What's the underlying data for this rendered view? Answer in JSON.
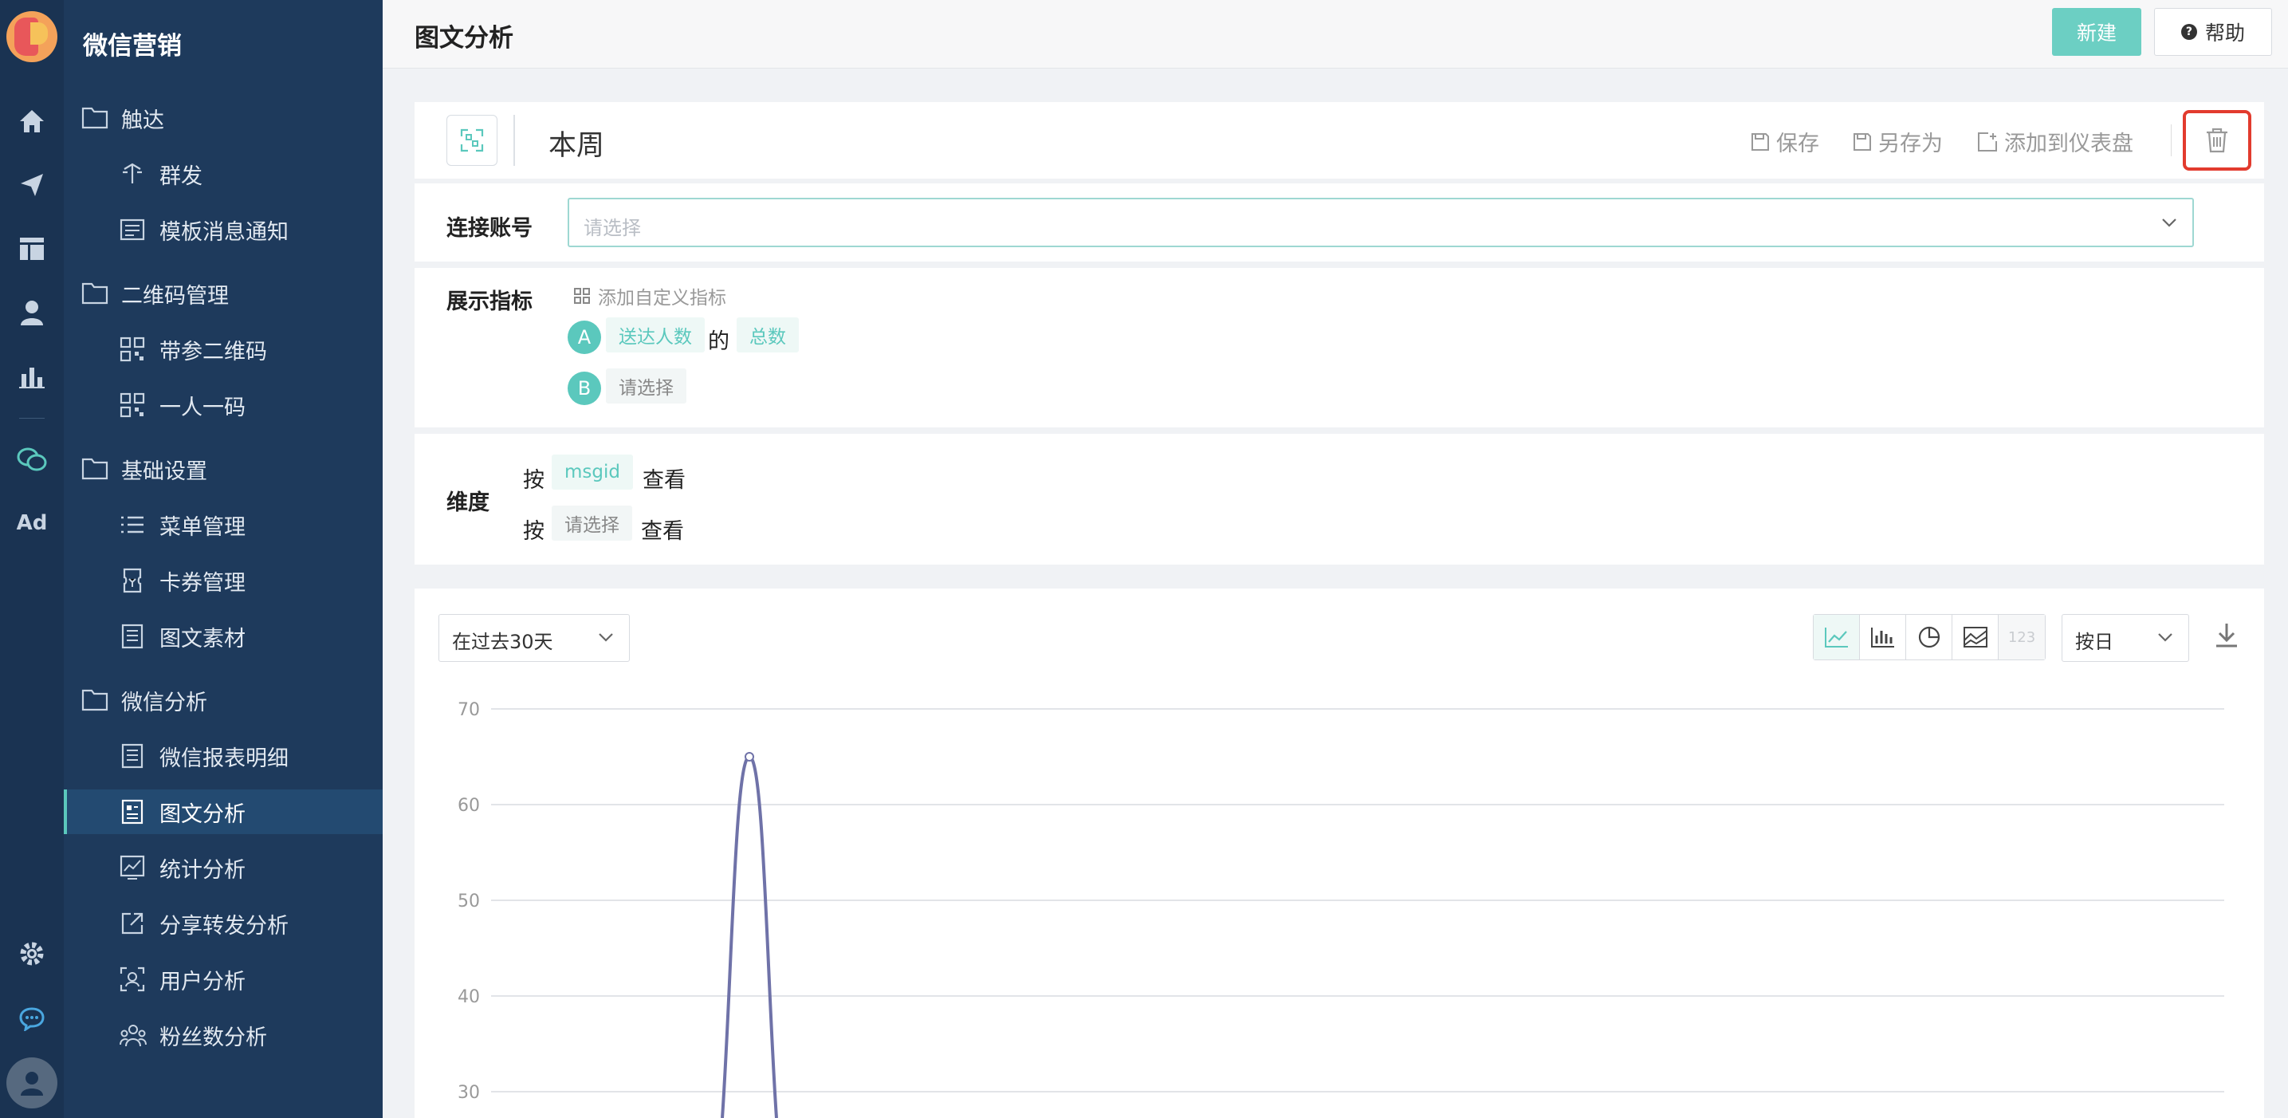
{
  "app": {
    "nav_title": "微信营销"
  },
  "rail": {
    "icons": [
      "home-icon",
      "send-icon",
      "dashboard-icon",
      "user-icon",
      "bar-chart-icon",
      "wechat-icon",
      "ad-icon",
      "settings-icon",
      "chat-icon",
      "avatar"
    ],
    "ad_label": "Ad"
  },
  "nav": {
    "groups": [
      {
        "label": "触达",
        "items": [
          {
            "label": "群发",
            "icon": "broadcast-icon"
          },
          {
            "label": "模板消息通知",
            "icon": "template-icon"
          }
        ]
      },
      {
        "label": "二维码管理",
        "items": [
          {
            "label": "带参二维码",
            "icon": "qrcode-icon"
          },
          {
            "label": "一人一码",
            "icon": "qrcode-icon"
          }
        ]
      },
      {
        "label": "基础设置",
        "items": [
          {
            "label": "菜单管理",
            "icon": "menu-list-icon"
          },
          {
            "label": "卡券管理",
            "icon": "coupon-icon"
          },
          {
            "label": "图文素材",
            "icon": "article-icon"
          }
        ]
      },
      {
        "label": "微信分析",
        "items": [
          {
            "label": "微信报表明细",
            "icon": "report-icon"
          },
          {
            "label": "图文分析",
            "icon": "article-analysis-icon",
            "active": true
          },
          {
            "label": "统计分析",
            "icon": "stats-icon"
          },
          {
            "label": "分享转发分析",
            "icon": "share-icon"
          },
          {
            "label": "用户分析",
            "icon": "user-analysis-icon"
          },
          {
            "label": "粉丝数分析",
            "icon": "fans-icon"
          }
        ]
      }
    ]
  },
  "header": {
    "title": "图文分析",
    "new_label": "新建",
    "help_label": "帮助"
  },
  "report": {
    "name": "本周",
    "actions": {
      "save": "保存",
      "save_as": "另存为",
      "add_dashboard": "添加到仪表盘"
    }
  },
  "account": {
    "label": "连接账号",
    "placeholder": "请选择"
  },
  "metrics": {
    "label": "展示指标",
    "add_custom": "添加自定义指标",
    "rows": [
      {
        "letter": "A",
        "metric": "送达人数",
        "of": "的",
        "agg": "总数"
      },
      {
        "letter": "B",
        "metric": "请选择"
      }
    ]
  },
  "dimension": {
    "label": "维度",
    "rows": [
      {
        "by": "按",
        "value": "msgid",
        "view": "查看"
      },
      {
        "by": "按",
        "value": "请选择",
        "view": "查看"
      }
    ]
  },
  "chart_controls": {
    "range": "在过去30天",
    "types": [
      "line-chart-icon",
      "bar-chart-icon",
      "pie-chart-icon",
      "area-chart-icon"
    ],
    "number_label": "123",
    "unit": "按日"
  },
  "chart_data": {
    "type": "line",
    "y_ticks": [
      "70",
      "60",
      "50",
      "40",
      "30"
    ],
    "ylim": [
      30,
      70
    ],
    "peak_value": 65,
    "line_color": "#6f72a8"
  },
  "colors": {
    "accent": "#5bc8bd",
    "sidebar": "#1e3a5c",
    "rail": "#1a3352",
    "danger": "#e23b2e"
  }
}
